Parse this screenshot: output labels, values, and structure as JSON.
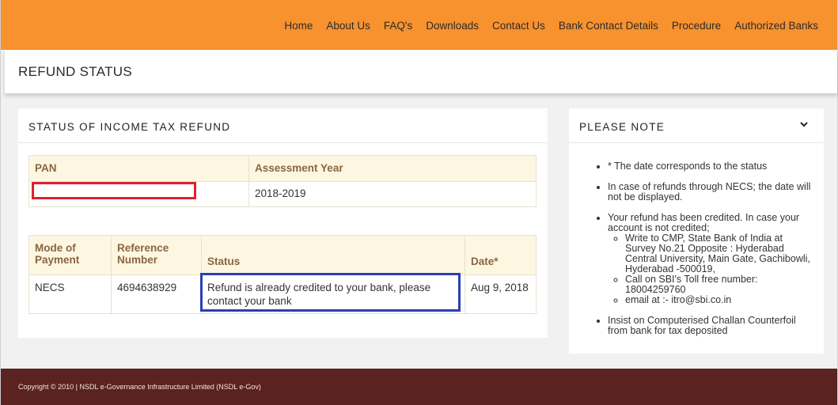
{
  "nav": {
    "items": [
      "Home",
      "About Us",
      "FAQ's",
      "Downloads",
      "Contact Us",
      "Bank Contact Details",
      "Procedure",
      "Authorized Banks"
    ],
    "bg_color": "#f7922f"
  },
  "page": {
    "title": "REFUND STATUS"
  },
  "status_panel": {
    "title": "STATUS OF INCOME TAX REFUND",
    "table1": {
      "headers": [
        "PAN",
        "Assessment Year"
      ],
      "row": {
        "pan": "",
        "assessment_year": "2018-2019"
      }
    },
    "table2": {
      "headers": [
        "Mode of Payment",
        "Reference Number",
        "Status",
        "Date*"
      ],
      "row": {
        "mode": "NECS",
        "reference": "4694638929",
        "status": "Refund is already credited to your bank, please contact your bank",
        "date": "Aug 9, 2018"
      }
    }
  },
  "note_panel": {
    "title": "PLEASE NOTE",
    "toggle_icon": "chevron-down-icon",
    "notes": [
      "* The date corresponds to the status",
      "In case of refunds through NECS; the date will not be displayed.",
      "Your refund has been credited. In case your account is not credited;",
      "Insist on Computerised Challan Counterfoil from bank for tax deposited"
    ],
    "sub_notes": [
      "Write to CMP, State Bank of India at Survey No.21 Opposite : Hyderabad Central University, Main Gate, Gachibowli, Hyderabad -500019,",
      "Call on SBI's Toll free number: 18004259760",
      "email at :- itro@sbi.co.in"
    ]
  },
  "footer": {
    "text": "Copyright © 2010 | NSDL e-Governance Infrastructure Limited (NSDL e-Gov)",
    "bg_color": "#5a2220"
  },
  "highlights": {
    "pan_box_color": "#e0202d",
    "status_box_color": "#2a3fb5"
  }
}
